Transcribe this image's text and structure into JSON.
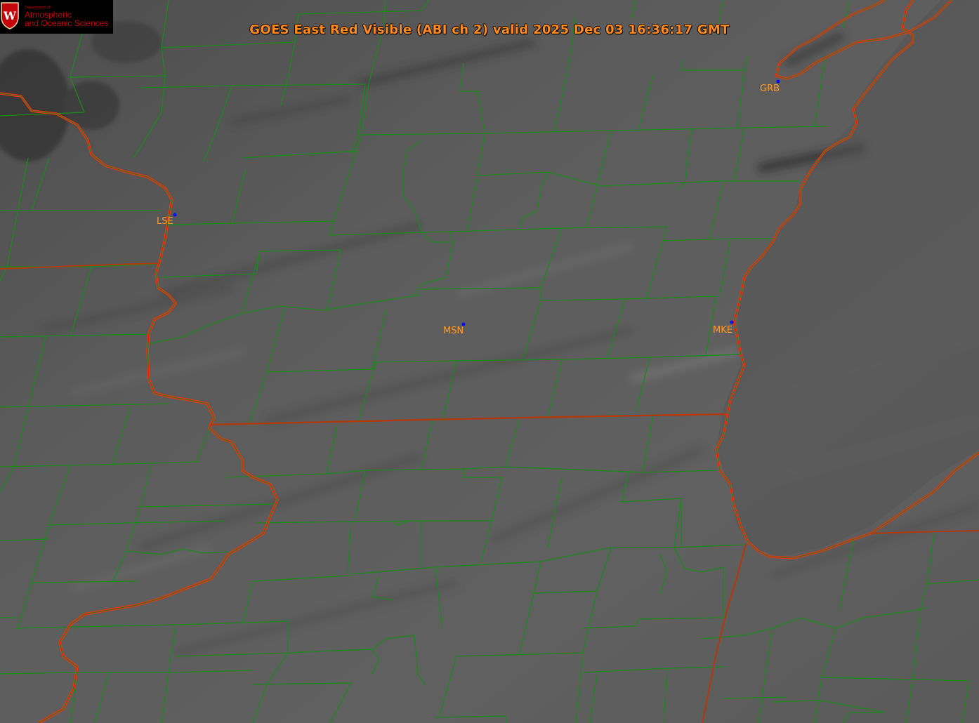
{
  "title": "GOES East Red Visible (ABI ch 2) valid 2025 Dec 03 16:36:17 GMT",
  "logo": {
    "dept": "Department of",
    "line1": "Atmospheric",
    "line2": "and Oceanic Sciences",
    "crest_letter": "W"
  },
  "stations": [
    {
      "id": "GRB",
      "label": "GRB"
    },
    {
      "id": "LSE",
      "label": "LSE"
    },
    {
      "id": "MSN",
      "label": "MSN"
    },
    {
      "id": "MKE",
      "label": "MKE"
    }
  ],
  "colors": {
    "background": "#5a5a5a",
    "county_lines": "#1a8a1a",
    "state_lines": "#ff2a10",
    "title_text": "#ff8a1f",
    "station_dot": "#0010ff",
    "station_label": "#ff9a2a",
    "logo_red": "#c5050c"
  }
}
